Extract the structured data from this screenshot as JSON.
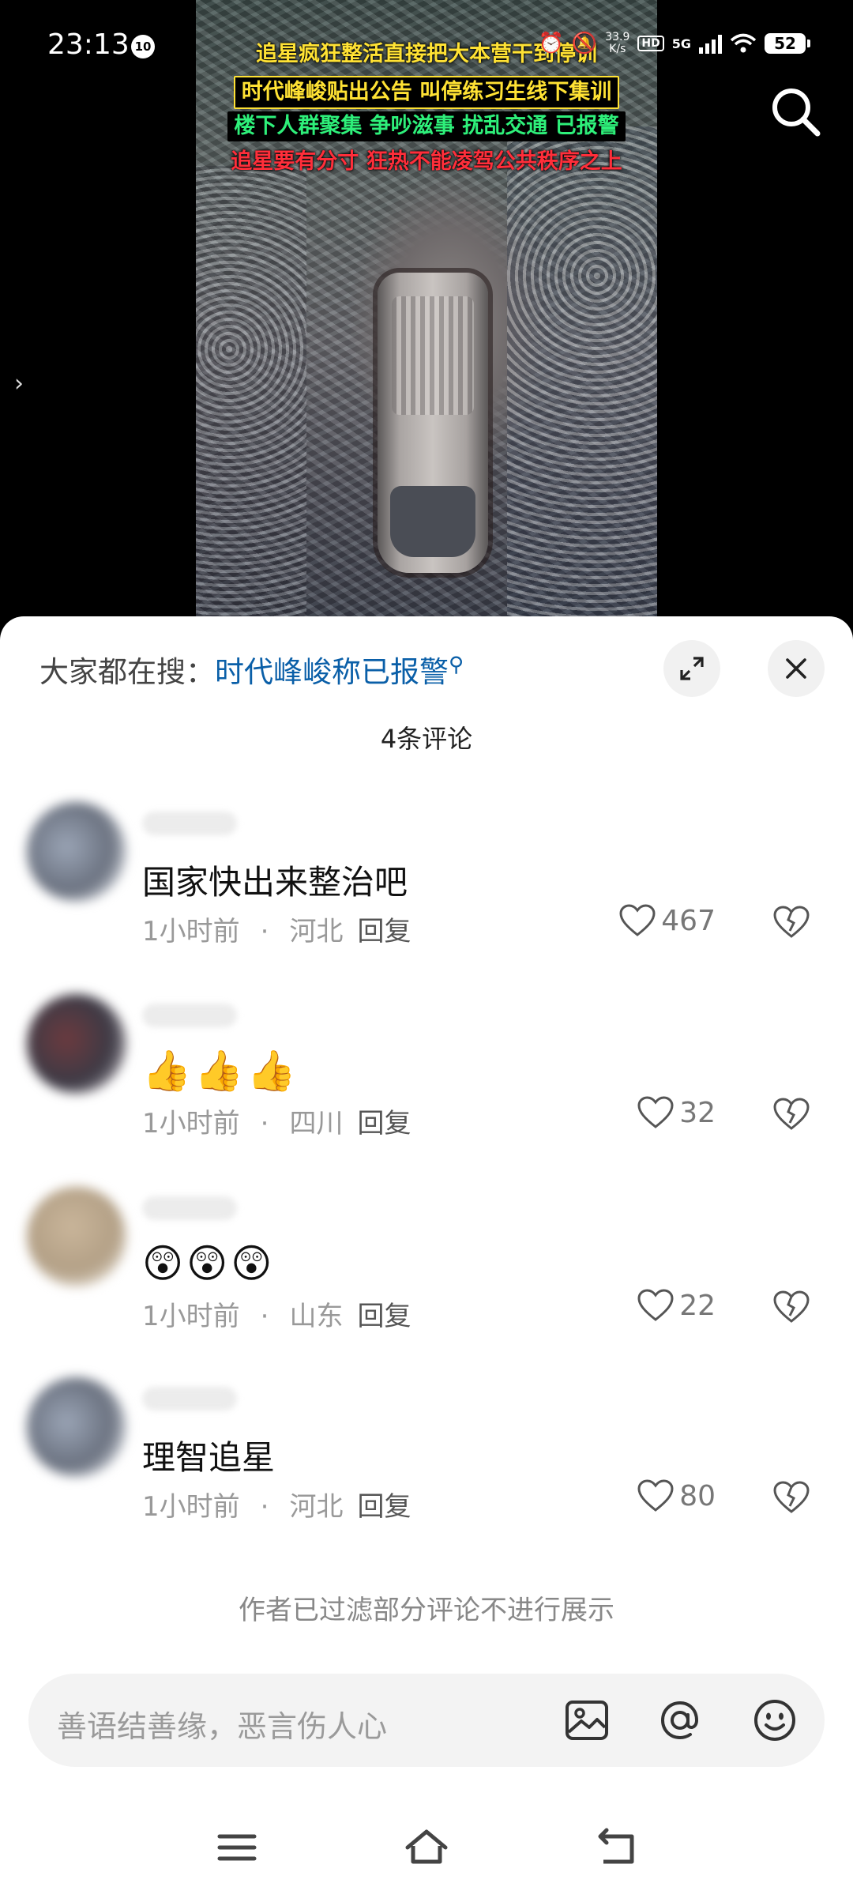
{
  "status_bar": {
    "time": "23:13",
    "notification_badge": "10",
    "net_speed": "33.9",
    "net_speed_unit": "K/s",
    "hd_label": "HD",
    "network": "5G",
    "battery": "52"
  },
  "video": {
    "captions": [
      "追星疯狂整活直接把大本营干到停训",
      "时代峰峻贴出公告 叫停练习生线下集训",
      "楼下人群聚集 争吵滋事 扰乱交通 已报警",
      "追星要有分寸 狂热不能凌驾公共秩序之上"
    ],
    "search_icon": "search-icon",
    "side_arrow": "›"
  },
  "comments_sheet": {
    "trending_prefix": "大家都在搜：",
    "trending_term": "时代峰峻称已报警",
    "trending_icon": "search-icon",
    "comment_count": "4条评论",
    "comments": [
      {
        "text": "国家快出来整治吧",
        "time": "1小时前",
        "location": "河北",
        "reply": "回复",
        "likes": "467"
      },
      {
        "text": "👍👍👍",
        "time": "1小时前",
        "location": "四川",
        "reply": "回复",
        "likes": "32"
      },
      {
        "text": "😲😲😲",
        "time": "1小时前",
        "location": "山东",
        "reply": "回复",
        "likes": "22"
      },
      {
        "text": "理智追星",
        "time": "1小时前",
        "location": "河北",
        "reply": "回复",
        "likes": "80"
      }
    ],
    "filter_note": "作者已过滤部分评论不进行展示"
  },
  "input_bar": {
    "placeholder": "善语结善缘，恶言伤人心",
    "icons": [
      "image-icon",
      "at-icon",
      "emoji-icon"
    ]
  },
  "colors": {
    "trending_term": "#0a5fa8",
    "caption_yellow": "#ffe234",
    "caption_green": "#2ef07a",
    "caption_red": "#ff2e3a"
  }
}
